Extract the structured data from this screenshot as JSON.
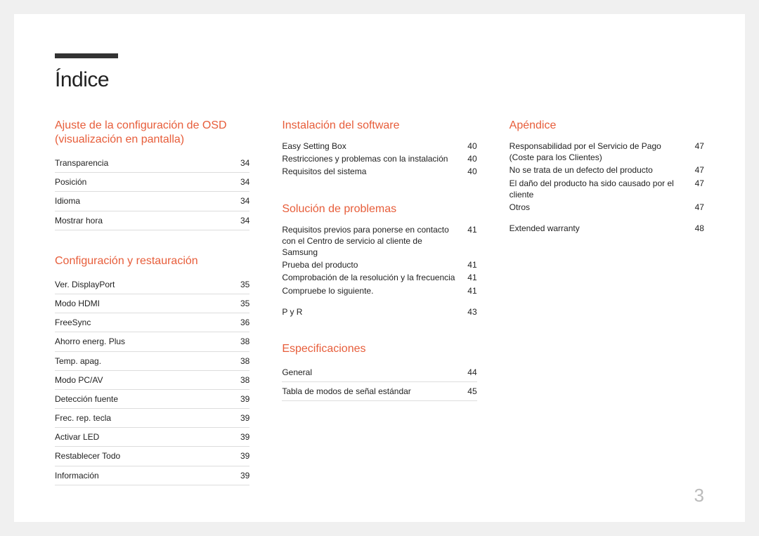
{
  "title": "Índice",
  "page_number": "3",
  "col1": {
    "section1": {
      "heading": "Ajuste de la configuración de OSD (visualización en pantalla)",
      "items": [
        {
          "label": "Transparencia",
          "page": "34"
        },
        {
          "label": "Posición",
          "page": "34"
        },
        {
          "label": "Idioma",
          "page": "34"
        },
        {
          "label": "Mostrar hora",
          "page": "34"
        }
      ]
    },
    "section2": {
      "heading": "Configuración y restauración",
      "items": [
        {
          "label": "Ver. DisplayPort",
          "page": "35"
        },
        {
          "label": "Modo HDMI",
          "page": "35"
        },
        {
          "label": "FreeSync",
          "page": "36"
        },
        {
          "label": "Ahorro energ. Plus",
          "page": "38"
        },
        {
          "label": "Temp. apag.",
          "page": "38"
        },
        {
          "label": "Modo PC/AV",
          "page": "38"
        },
        {
          "label": "Detección fuente",
          "page": "39"
        },
        {
          "label": "Frec. rep. tecla",
          "page": "39"
        },
        {
          "label": "Activar LED",
          "page": "39"
        },
        {
          "label": "Restablecer Todo",
          "page": "39"
        },
        {
          "label": "Información",
          "page": "39"
        }
      ]
    }
  },
  "col2": {
    "section1": {
      "heading": "Instalación del software",
      "items": [
        {
          "label": "Easy Setting Box",
          "page": "40"
        },
        {
          "label": "Restricciones y problemas con la instalación",
          "page": "40"
        },
        {
          "label": "Requisitos del sistema",
          "page": "40"
        }
      ]
    },
    "section2": {
      "heading": "Solución de problemas",
      "items": [
        {
          "label": "Requisitos previos para ponerse en contacto con el Centro de servicio al cliente de Samsung",
          "page": "41"
        },
        {
          "label": "Prueba del producto",
          "page": "41"
        },
        {
          "label": "Comprobación de la resolución y la frecuencia",
          "page": "41"
        },
        {
          "label": "Compruebe lo siguiente.",
          "page": "41"
        }
      ],
      "items2": [
        {
          "label": "P y R",
          "page": "43"
        }
      ]
    },
    "section3": {
      "heading": "Especificaciones",
      "items": [
        {
          "label": "General",
          "page": "44"
        },
        {
          "label": "Tabla de modos de señal estándar",
          "page": "45"
        }
      ]
    }
  },
  "col3": {
    "section1": {
      "heading": "Apéndice",
      "items": [
        {
          "label": "Responsabilidad por el Servicio de Pago (Coste para los Clientes)",
          "page": "47"
        },
        {
          "label": "No se trata de un defecto del producto",
          "page": "47"
        },
        {
          "label": "El daño del producto ha sido causado por el cliente",
          "page": "47"
        },
        {
          "label": "Otros",
          "page": "47"
        }
      ],
      "items2": [
        {
          "label": "Extended warranty",
          "page": "48"
        }
      ]
    }
  }
}
